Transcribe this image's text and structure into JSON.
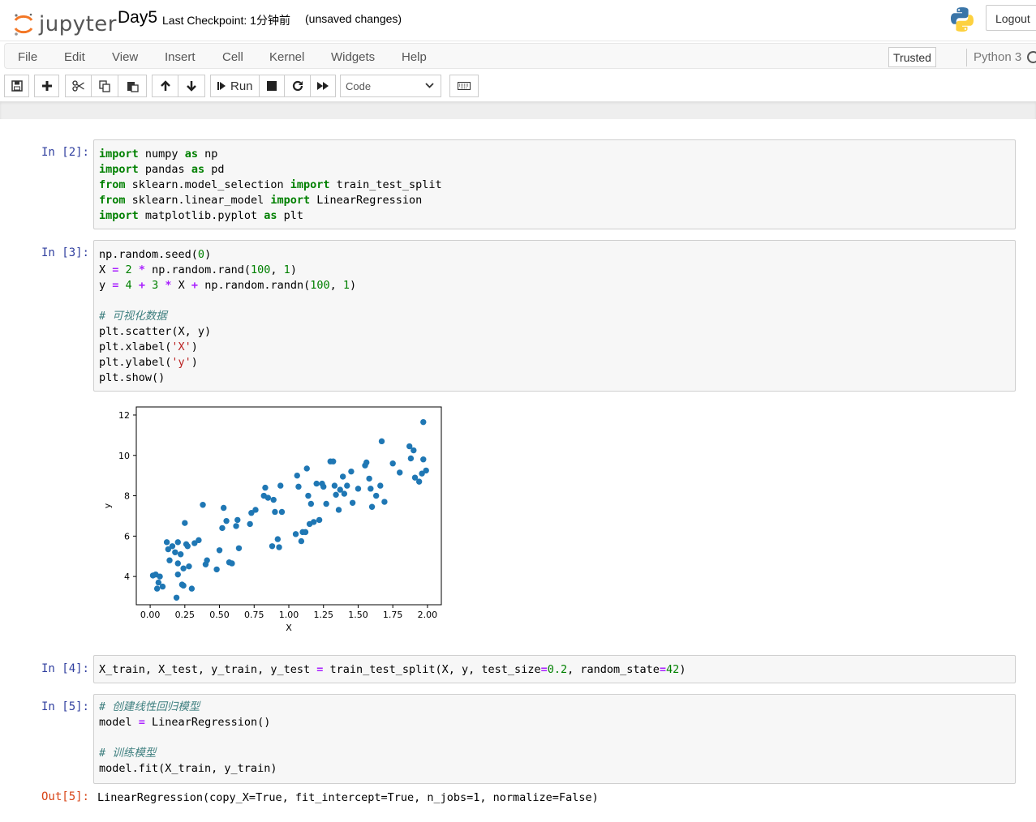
{
  "header": {
    "logo_text": "jupyter",
    "notebook_name": "Day5",
    "checkpoint": "Last Checkpoint: 1分钟前",
    "unsaved": "(unsaved changes)",
    "logout_label": "Logout"
  },
  "menu": {
    "items": [
      "File",
      "Edit",
      "View",
      "Insert",
      "Cell",
      "Kernel",
      "Widgets",
      "Help"
    ],
    "trusted_label": "Trusted",
    "kernel_name": "Python 3"
  },
  "toolbar": {
    "run_label": "Run",
    "cell_type": "Code"
  },
  "cells": [
    {
      "prompt": "In  [2]:",
      "lines": [
        "import numpy as np",
        "import pandas as pd",
        "from sklearn.model_selection import train_test_split",
        "from sklearn.linear_model import LinearRegression",
        "import matplotlib.pyplot as plt"
      ]
    },
    {
      "prompt": "In  [3]:",
      "lines": [
        "np.random.seed(0)",
        "X = 2 * np.random.rand(100, 1)",
        "y = 4 + 3 * X + np.random.randn(100, 1)",
        "",
        "# 可视化数据",
        "plt.scatter(X, y)",
        "plt.xlabel('X')",
        "plt.ylabel('y')",
        "plt.show()"
      ]
    },
    {
      "prompt": "In  [4]:",
      "lines": [
        "X_train, X_test, y_train, y_test = train_test_split(X, y, test_size=0.2, random_state=42)"
      ]
    },
    {
      "prompt": "In  [5]:",
      "lines": [
        "# 创建线性回归模型",
        "model = LinearRegression()",
        "",
        "# 训练模型",
        "model.fit(X_train, y_train)"
      ],
      "out_prompt": "Out[5]:",
      "output": "LinearRegression(copy_X=True, fit_intercept=True, n_jobs=1, normalize=False)"
    }
  ],
  "chart_data": {
    "type": "scatter",
    "xlabel": "X",
    "ylabel": "y",
    "xlim": [
      -0.1,
      2.1
    ],
    "ylim": [
      2.6,
      12.4
    ],
    "xticks": [
      "0.00",
      "0.25",
      "0.50",
      "0.75",
      "1.00",
      "1.25",
      "1.50",
      "1.75",
      "2.00"
    ],
    "yticks": [
      "4",
      "6",
      "8",
      "10",
      "12"
    ],
    "point_color": "#1f77b4",
    "points": [
      [
        0.02,
        4.05
      ],
      [
        0.04,
        4.1
      ],
      [
        0.05,
        3.4
      ],
      [
        0.06,
        3.7
      ],
      [
        0.07,
        4.0
      ],
      [
        0.09,
        3.5
      ],
      [
        0.12,
        5.7
      ],
      [
        0.13,
        5.35
      ],
      [
        0.14,
        4.8
      ],
      [
        0.16,
        5.5
      ],
      [
        0.18,
        5.2
      ],
      [
        0.19,
        2.95
      ],
      [
        0.2,
        4.1
      ],
      [
        0.2,
        4.65
      ],
      [
        0.2,
        5.7
      ],
      [
        0.22,
        5.1
      ],
      [
        0.23,
        3.6
      ],
      [
        0.24,
        4.4
      ],
      [
        0.24,
        3.55
      ],
      [
        0.25,
        6.65
      ],
      [
        0.26,
        5.6
      ],
      [
        0.27,
        5.5
      ],
      [
        0.28,
        4.5
      ],
      [
        0.3,
        3.4
      ],
      [
        0.32,
        5.65
      ],
      [
        0.35,
        5.8
      ],
      [
        0.38,
        7.55
      ],
      [
        0.4,
        4.6
      ],
      [
        0.41,
        4.8
      ],
      [
        0.48,
        4.35
      ],
      [
        0.5,
        5.3
      ],
      [
        0.52,
        6.4
      ],
      [
        0.53,
        7.4
      ],
      [
        0.55,
        6.75
      ],
      [
        0.57,
        4.7
      ],
      [
        0.59,
        4.65
      ],
      [
        0.62,
        6.5
      ],
      [
        0.63,
        6.8
      ],
      [
        0.64,
        5.4
      ],
      [
        0.72,
        6.6
      ],
      [
        0.73,
        7.15
      ],
      [
        0.76,
        7.3
      ],
      [
        0.82,
        8.0
      ],
      [
        0.83,
        8.4
      ],
      [
        0.85,
        7.9
      ],
      [
        0.88,
        5.5
      ],
      [
        0.89,
        7.8
      ],
      [
        0.9,
        7.2
      ],
      [
        0.92,
        5.85
      ],
      [
        0.93,
        5.45
      ],
      [
        0.94,
        8.5
      ],
      [
        0.95,
        7.2
      ],
      [
        1.05,
        6.1
      ],
      [
        1.06,
        9.0
      ],
      [
        1.07,
        8.45
      ],
      [
        1.09,
        5.75
      ],
      [
        1.1,
        6.2
      ],
      [
        1.12,
        6.2
      ],
      [
        1.13,
        9.35
      ],
      [
        1.14,
        8.0
      ],
      [
        1.15,
        6.6
      ],
      [
        1.16,
        7.6
      ],
      [
        1.18,
        6.7
      ],
      [
        1.2,
        8.6
      ],
      [
        1.22,
        6.8
      ],
      [
        1.24,
        8.6
      ],
      [
        1.25,
        8.45
      ],
      [
        1.27,
        7.6
      ],
      [
        1.3,
        9.7
      ],
      [
        1.32,
        9.7
      ],
      [
        1.33,
        8.5
      ],
      [
        1.34,
        8.05
      ],
      [
        1.36,
        7.3
      ],
      [
        1.37,
        8.3
      ],
      [
        1.39,
        8.95
      ],
      [
        1.4,
        8.1
      ],
      [
        1.42,
        8.5
      ],
      [
        1.45,
        9.2
      ],
      [
        1.46,
        7.65
      ],
      [
        1.5,
        8.35
      ],
      [
        1.55,
        9.5
      ],
      [
        1.56,
        9.65
      ],
      [
        1.58,
        8.85
      ],
      [
        1.59,
        8.35
      ],
      [
        1.6,
        7.45
      ],
      [
        1.63,
        8.0
      ],
      [
        1.66,
        8.5
      ],
      [
        1.67,
        10.7
      ],
      [
        1.69,
        7.7
      ],
      [
        1.75,
        9.6
      ],
      [
        1.8,
        9.15
      ],
      [
        1.87,
        10.45
      ],
      [
        1.88,
        9.85
      ],
      [
        1.9,
        10.25
      ],
      [
        1.91,
        8.9
      ],
      [
        1.94,
        8.7
      ],
      [
        1.96,
        9.1
      ],
      [
        1.97,
        9.8
      ],
      [
        1.97,
        11.65
      ],
      [
        1.99,
        9.25
      ]
    ]
  }
}
